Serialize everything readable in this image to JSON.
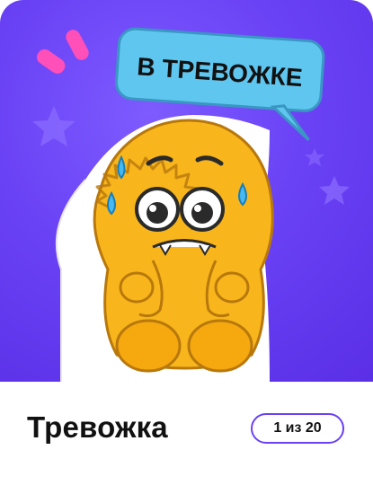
{
  "sticker": {
    "bubble_text": "В ТРЕВОЖКЕ",
    "icon": "anxious-yellow-monster"
  },
  "footer": {
    "title": "Тревожка",
    "counter": "1 из 20"
  },
  "colors": {
    "background": "#6a42f5",
    "bubble": "#5fc6f0",
    "accent": "#6a42f5",
    "monster": "#f8b61c",
    "exclaim": "#ff4fb8"
  }
}
